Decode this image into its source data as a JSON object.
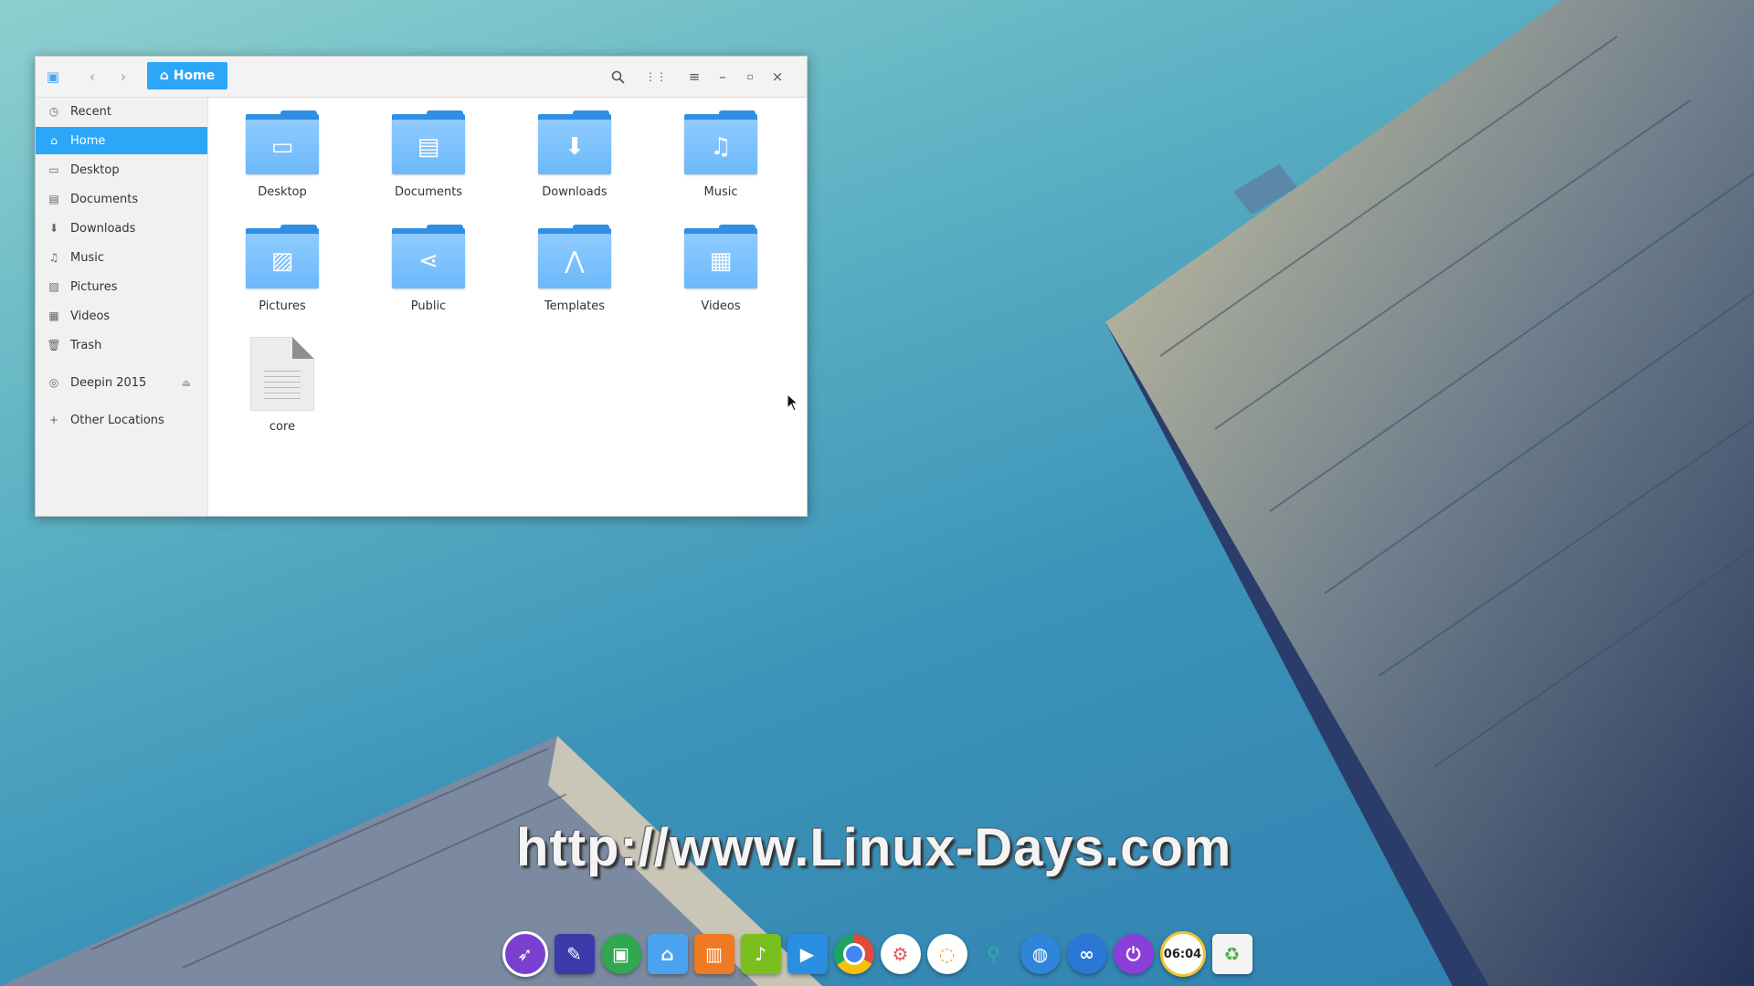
{
  "desktop": {
    "watermark": "http://www.Linux-Days.com"
  },
  "window": {
    "path_button": "Home",
    "toolbar": {
      "back_icon": "chevron-left-icon",
      "forward_icon": "chevron-right-icon",
      "search_icon": "search-icon",
      "grid_icon": "grid-view-icon",
      "menu_icon": "hamburger-menu-icon",
      "minimize_icon": "minimize-icon",
      "maximize_icon": "maximize-icon",
      "close_icon": "close-icon"
    },
    "sidebar": {
      "items": [
        {
          "label": "Recent",
          "icon": "clock-icon"
        },
        {
          "label": "Home",
          "icon": "home-icon",
          "active": true
        },
        {
          "label": "Desktop",
          "icon": "desktop-icon"
        },
        {
          "label": "Documents",
          "icon": "document-icon"
        },
        {
          "label": "Downloads",
          "icon": "download-icon"
        },
        {
          "label": "Music",
          "icon": "music-icon"
        },
        {
          "label": "Pictures",
          "icon": "picture-icon"
        },
        {
          "label": "Videos",
          "icon": "video-icon"
        },
        {
          "label": "Trash",
          "icon": "trash-icon"
        },
        {
          "label": "Deepin 2015",
          "icon": "disc-icon"
        },
        {
          "label": "Other Locations",
          "icon": "plus-icon"
        }
      ]
    },
    "files": [
      {
        "label": "Desktop",
        "icon": "desktop-icon"
      },
      {
        "label": "Documents",
        "icon": "document-icon"
      },
      {
        "label": "Downloads",
        "icon": "download-icon"
      },
      {
        "label": "Music",
        "icon": "music-icon"
      },
      {
        "label": "Pictures",
        "icon": "picture-icon"
      },
      {
        "label": "Public",
        "icon": "share-icon"
      },
      {
        "label": "Templates",
        "icon": "compass-icon"
      },
      {
        "label": "Videos",
        "icon": "film-icon"
      },
      {
        "label": "core",
        "icon": "text-file-icon"
      }
    ]
  },
  "dock": {
    "apps": [
      {
        "name": "launcher-icon",
        "color": "#7b3fd0"
      },
      {
        "name": "text-editor-icon",
        "color": "#3a3aa8"
      },
      {
        "name": "app-store-icon",
        "color": "#2fa84f"
      },
      {
        "name": "file-manager-icon",
        "color": "#4aa3f0"
      },
      {
        "name": "store-bag-icon",
        "color": "#ef7a22"
      },
      {
        "name": "music-player-icon",
        "color": "#7bbf1e"
      },
      {
        "name": "video-player-icon",
        "color": "#2a8fe0"
      },
      {
        "name": "chrome-icon",
        "color": "#dd4b39"
      },
      {
        "name": "settings-icon",
        "color": "#e05a5a"
      },
      {
        "name": "screenshot-icon",
        "color": "#f2a12f"
      },
      {
        "name": "usb-icon",
        "color": "#2bb5a0"
      },
      {
        "name": "browser-globe-icon",
        "color": "#2f86d8"
      },
      {
        "name": "link-icon",
        "color": "#2a77d6"
      },
      {
        "name": "power-icon",
        "color": "#8a3fd8"
      },
      {
        "name": "clock-app-icon",
        "color": "#f1c232",
        "text": "06:04"
      },
      {
        "name": "recycle-bin-icon",
        "color": "#f4f4f4"
      }
    ]
  }
}
